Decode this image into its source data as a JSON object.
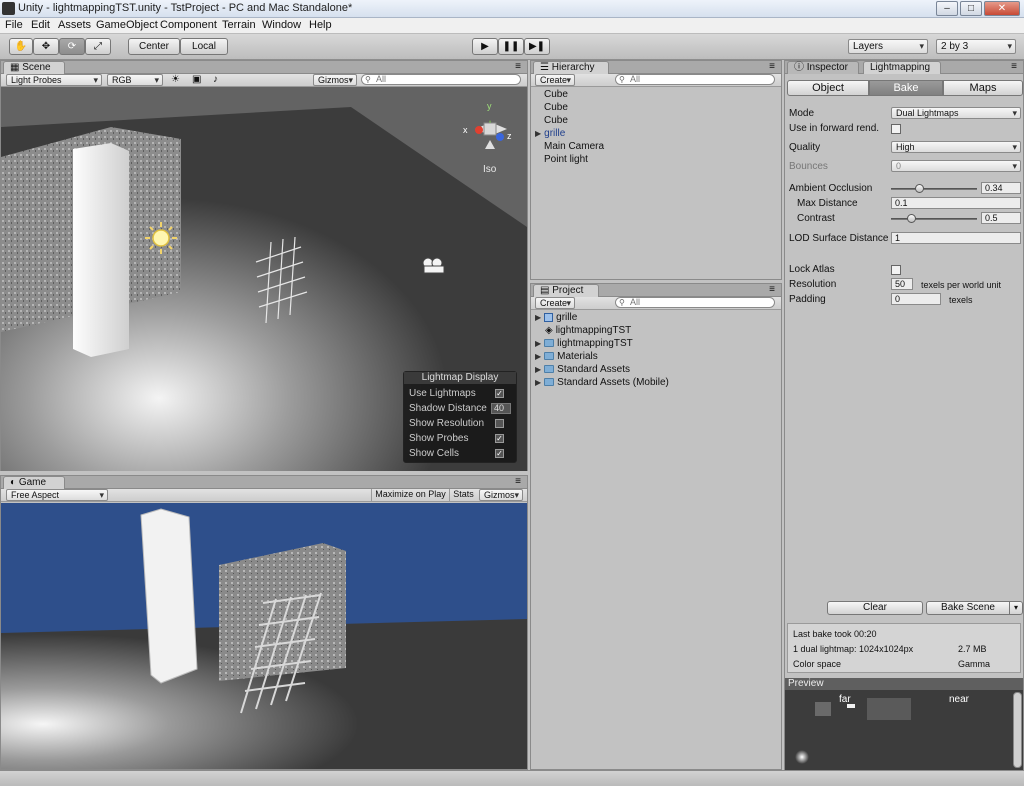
{
  "window": {
    "title": "Unity - lightmappingTST.unity - TstProject - PC and Mac Standalone*"
  },
  "menu": [
    "File",
    "Edit",
    "Assets",
    "GameObject",
    "Component",
    "Terrain",
    "Window",
    "Help"
  ],
  "toolbar": {
    "pivot": "Center",
    "space": "Local",
    "layers": "Layers",
    "layout": "2 by 3"
  },
  "scene": {
    "tab": "Scene",
    "render_mode": "Light Probes",
    "color_mode": "RGB",
    "gizmos": "Gizmos",
    "search_placeholder": "All",
    "view_label": "Iso",
    "gizmo_axes": {
      "y": "y",
      "x": "x",
      "z": "z"
    }
  },
  "lightmap_display": {
    "title": "Lightmap Display",
    "rows": [
      {
        "label": "Use Lightmaps",
        "checked": true
      },
      {
        "label": "Shadow Distance",
        "value": "40"
      },
      {
        "label": "Show Resolution",
        "checked": false
      },
      {
        "label": "Show Probes",
        "checked": true
      },
      {
        "label": "Show Cells",
        "checked": true
      }
    ]
  },
  "game": {
    "tab": "Game",
    "aspect": "Free Aspect",
    "maximize": "Maximize on Play",
    "stats": "Stats",
    "gizmos": "Gizmos"
  },
  "hierarchy": {
    "tab": "Hierarchy",
    "create": "Create",
    "search_placeholder": "All",
    "items": [
      {
        "label": "Cube",
        "expandable": false
      },
      {
        "label": "Cube",
        "expandable": false
      },
      {
        "label": "Cube",
        "expandable": false
      },
      {
        "label": "grille",
        "expandable": true
      },
      {
        "label": "Main Camera",
        "expandable": false
      },
      {
        "label": "Point light",
        "expandable": false
      }
    ]
  },
  "project": {
    "tab": "Project",
    "create": "Create",
    "search_placeholder": "All",
    "items": [
      {
        "label": "grille",
        "kind": "prefab"
      },
      {
        "label": "lightmappingTST",
        "kind": "scene"
      },
      {
        "label": "lightmappingTST",
        "kind": "folder"
      },
      {
        "label": "Materials",
        "kind": "folder"
      },
      {
        "label": "Standard Assets",
        "kind": "folder"
      },
      {
        "label": "Standard Assets (Mobile)",
        "kind": "folder"
      }
    ]
  },
  "inspector": {
    "tabs": [
      "Inspector",
      "Lightmapping"
    ],
    "modes": [
      "Object",
      "Bake",
      "Maps"
    ],
    "mode_label": "Mode",
    "mode_value": "Dual Lightmaps",
    "forward_label": "Use in forward rend.",
    "quality_label": "Quality",
    "quality_value": "High",
    "bounces_label": "Bounces",
    "bounces_value": "0",
    "ao_label": "Ambient Occlusion",
    "ao_value": "0.34",
    "max_distance_label": "Max Distance",
    "max_distance_value": "0.1",
    "contrast_label": "Contrast",
    "contrast_value": "0.5",
    "lod_label": "LOD Surface Distance",
    "lod_value": "1",
    "lock_atlas_label": "Lock Atlas",
    "resolution_label": "Resolution",
    "resolution_value": "50",
    "resolution_unit": "texels per world unit",
    "padding_label": "Padding",
    "padding_value": "0",
    "padding_unit": "texels",
    "clear_button": "Clear",
    "bake_button": "Bake Scene",
    "info": {
      "last_bake": "Last bake took 00:20",
      "lightmap_line": "1 dual lightmap: 1024x1024px",
      "size": "2.7 MB",
      "color_space_label": "Color space",
      "color_space_value": "Gamma"
    },
    "preview_title": "Preview",
    "preview_far": "far",
    "preview_near": "near"
  }
}
